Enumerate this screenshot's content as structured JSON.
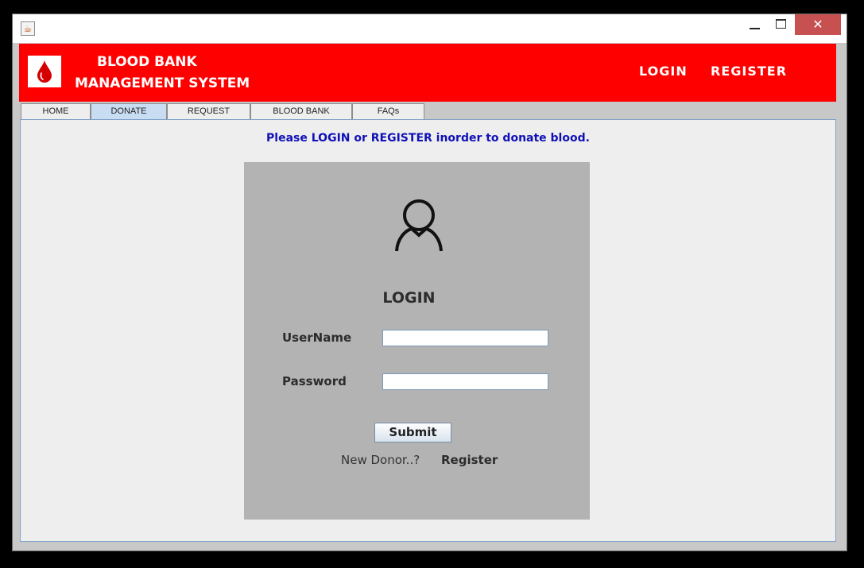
{
  "window": {
    "close_glyph": "✕"
  },
  "header": {
    "brand_line1": "BLOOD BANK",
    "brand_line2": "MANAGEMENT SYSTEM",
    "login_link": "LOGIN",
    "register_link": "REGISTER",
    "logo_icon": "blood-drop-icon",
    "background_color": "#ff0000"
  },
  "tabs": [
    {
      "label": "HOME",
      "active": false
    },
    {
      "label": "DONATE",
      "active": true
    },
    {
      "label": "REQUEST",
      "active": false
    },
    {
      "label": "BLOOD BANK",
      "active": false
    },
    {
      "label": "FAQs",
      "active": false
    }
  ],
  "main": {
    "notice": "Please LOGIN or REGISTER inorder to donate blood.",
    "notice_color": "#1010b8",
    "login_form": {
      "icon": "user-icon",
      "title": "LOGIN",
      "username_label": "UserName",
      "username_value": "",
      "password_label": "Password",
      "password_value": "",
      "submit_label": "Submit",
      "new_donor_text": "New Donor..?",
      "register_label": "Register"
    }
  }
}
